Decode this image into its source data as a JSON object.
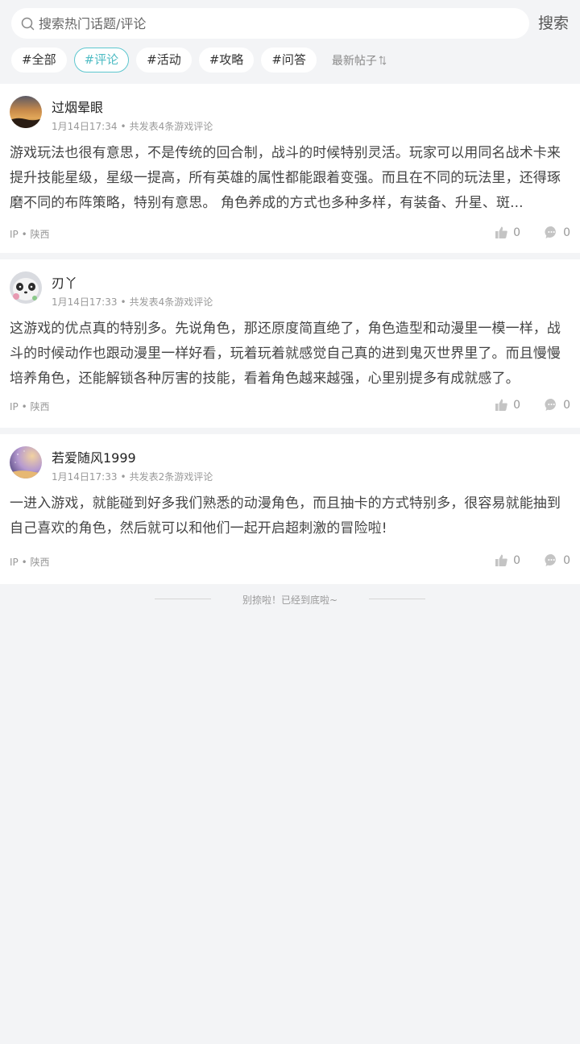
{
  "search": {
    "placeholder": "搜索热门话题/评论",
    "button_label": "搜索"
  },
  "tags": [
    {
      "label": "#全部",
      "active": false
    },
    {
      "label": "#评论",
      "active": true
    },
    {
      "label": "#活动",
      "active": false
    },
    {
      "label": "#攻略",
      "active": false
    },
    {
      "label": "#问答",
      "active": false
    }
  ],
  "sort": {
    "label": "最新帖子"
  },
  "posts": [
    {
      "username": "过烟晕眼",
      "time": "1月14日17:34",
      "stat": "共发表4条游戏评论",
      "content": "游戏玩法也很有意思，不是传统的回合制，战斗的时候特别灵活。玩家可以用同名战术卡来提升技能星级，星级一提高，所有英雄的属性都能跟着变强。而且在不同的玩法里，还得琢磨不同的布阵策略，特别有意思。 角色养成的方式也多种多样，有装备、升星、斑...",
      "ip": "IP • 陕西",
      "likes": "0",
      "comments": "0"
    },
    {
      "username": "刃丫",
      "time": "1月14日17:33",
      "stat": "共发表4条游戏评论",
      "content": "这游戏的优点真的特别多。先说角色，那还原度简直绝了，角色造型和动漫里一模一样，战斗的时候动作也跟动漫里一样好看，玩着玩着就感觉自己真的进到鬼灭世界里了。而且慢慢培养角色，还能解锁各种厉害的技能，看着角色越来越强，心里别提多有成就感了。",
      "ip": "IP • 陕西",
      "likes": "0",
      "comments": "0"
    },
    {
      "username": "若爱随风1999",
      "time": "1月14日17:33",
      "stat": "共发表2条游戏评论",
      "content": "一进入游戏，就能碰到好多我们熟悉的动漫角色，而且抽卡的方式特别多，很容易就能抽到自己喜欢的角色，然后就可以和他们一起开启超刺激的冒险啦!",
      "ip": "IP • 陕西",
      "likes": "0",
      "comments": "0"
    }
  ],
  "footer": {
    "end_text": "别捺啦！已经到底啦~"
  },
  "colors": {
    "accent": "#4fbcc4",
    "background": "#f3f4f6"
  }
}
